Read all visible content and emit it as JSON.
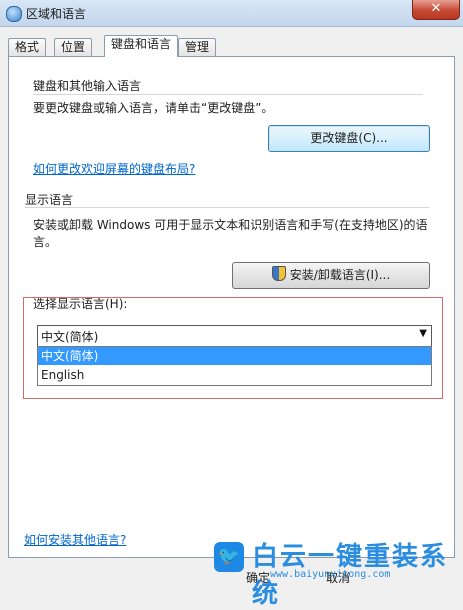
{
  "window": {
    "title": "区域和语言",
    "close_glyph": "✕"
  },
  "tabs": [
    {
      "label": "格式"
    },
    {
      "label": "位置"
    },
    {
      "label": "键盘和语言",
      "active": true
    },
    {
      "label": "管理"
    }
  ],
  "keyboard_section": {
    "heading": "键盘和其他输入语言",
    "description": "要更改键盘或输入语言，请单击“更改键盘”。",
    "change_button": "更改键盘(C)...",
    "layout_link": "如何更改欢迎屏幕的键盘布局?"
  },
  "display_section": {
    "heading": "显示语言",
    "description_line1": "安装或卸载 Windows 可用于显示文本和识别语言和手写(在支持地区)的语",
    "description_line2": "言。",
    "install_button": "安装/卸载语言(I)...",
    "select_label": "选择显示语言(H):",
    "selected_value": "中文(简体)",
    "options": [
      "中文(简体)",
      "English"
    ]
  },
  "footer": {
    "install_link": "如何安装其他语言?",
    "ok_button": "确定",
    "cancel_button": "取消"
  },
  "watermark": {
    "title": "白云一键重装系统",
    "url": "www.baiyunxitong.com",
    "icon": "twitter-bird-icon"
  }
}
